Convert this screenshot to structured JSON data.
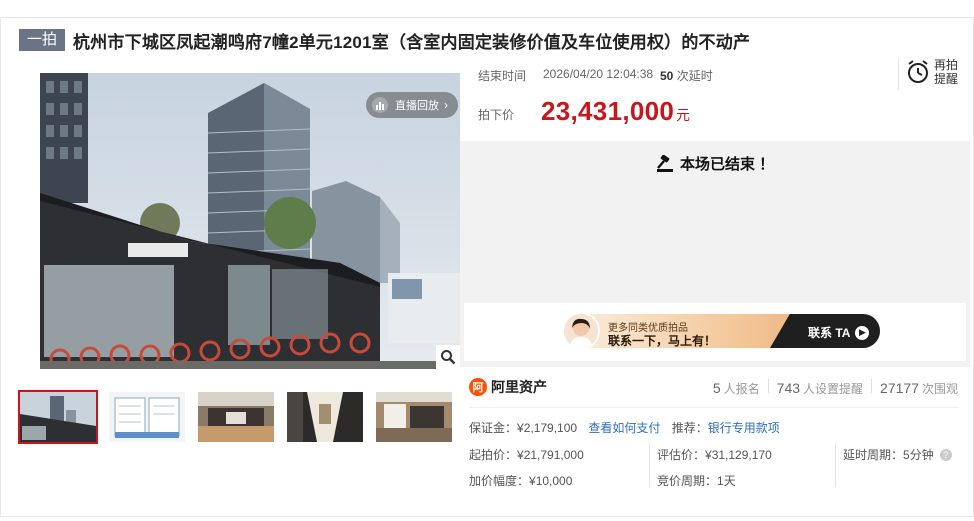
{
  "title": {
    "badge": "一拍",
    "text": "杭州市下城区凤起潮鸣府7幢2单元1201室（含室内固定装修价值及车位使用权）的不动产"
  },
  "media": {
    "replay_label": "直播回放",
    "thumbnails": [
      "building",
      "floorplan",
      "kitchen",
      "corridor",
      "room"
    ]
  },
  "auction": {
    "end_label": "结束时间",
    "end_time": "2026/04/20 12:04:38",
    "extensions_num": "50",
    "extensions_label": "次延时",
    "remind_line1": "再拍",
    "remind_line2": "提醒",
    "price_label": "拍下价",
    "price": "23,431,000",
    "price_unit": "元",
    "status": "本场已结束 ！"
  },
  "promo": {
    "sub": "更多同类优质拍品",
    "main": "联系一下，马上有！",
    "cta": "联系 TA"
  },
  "brand": {
    "logo_char": "阿",
    "name": "阿里资产"
  },
  "stats": [
    {
      "num": "5",
      "label": "人报名"
    },
    {
      "num": "743",
      "label": "人设置提醒"
    },
    {
      "num": "27177",
      "label": "次围观"
    }
  ],
  "details": {
    "deposit_label": "保证金：",
    "deposit_value": "¥2,179,100",
    "deposit_link": "查看如何支付",
    "recommend_label": "推荐：",
    "recommend_link": "银行专用款项",
    "start_price_label": "起拍价：",
    "start_price_value": "¥21,791,000",
    "increment_label": "加价幅度：",
    "increment_value": "¥10,000",
    "appraise_label": "评估价：",
    "appraise_value": "¥31,129,170",
    "bid_cycle_label": "竞价周期：",
    "bid_cycle_value": "1天",
    "delay_label": "延时周期：",
    "delay_value": "5分钟"
  },
  "colors": {
    "accent_red": "#c8161d",
    "link_blue": "#2f6fbd",
    "brand_orange": "#ff5000"
  }
}
